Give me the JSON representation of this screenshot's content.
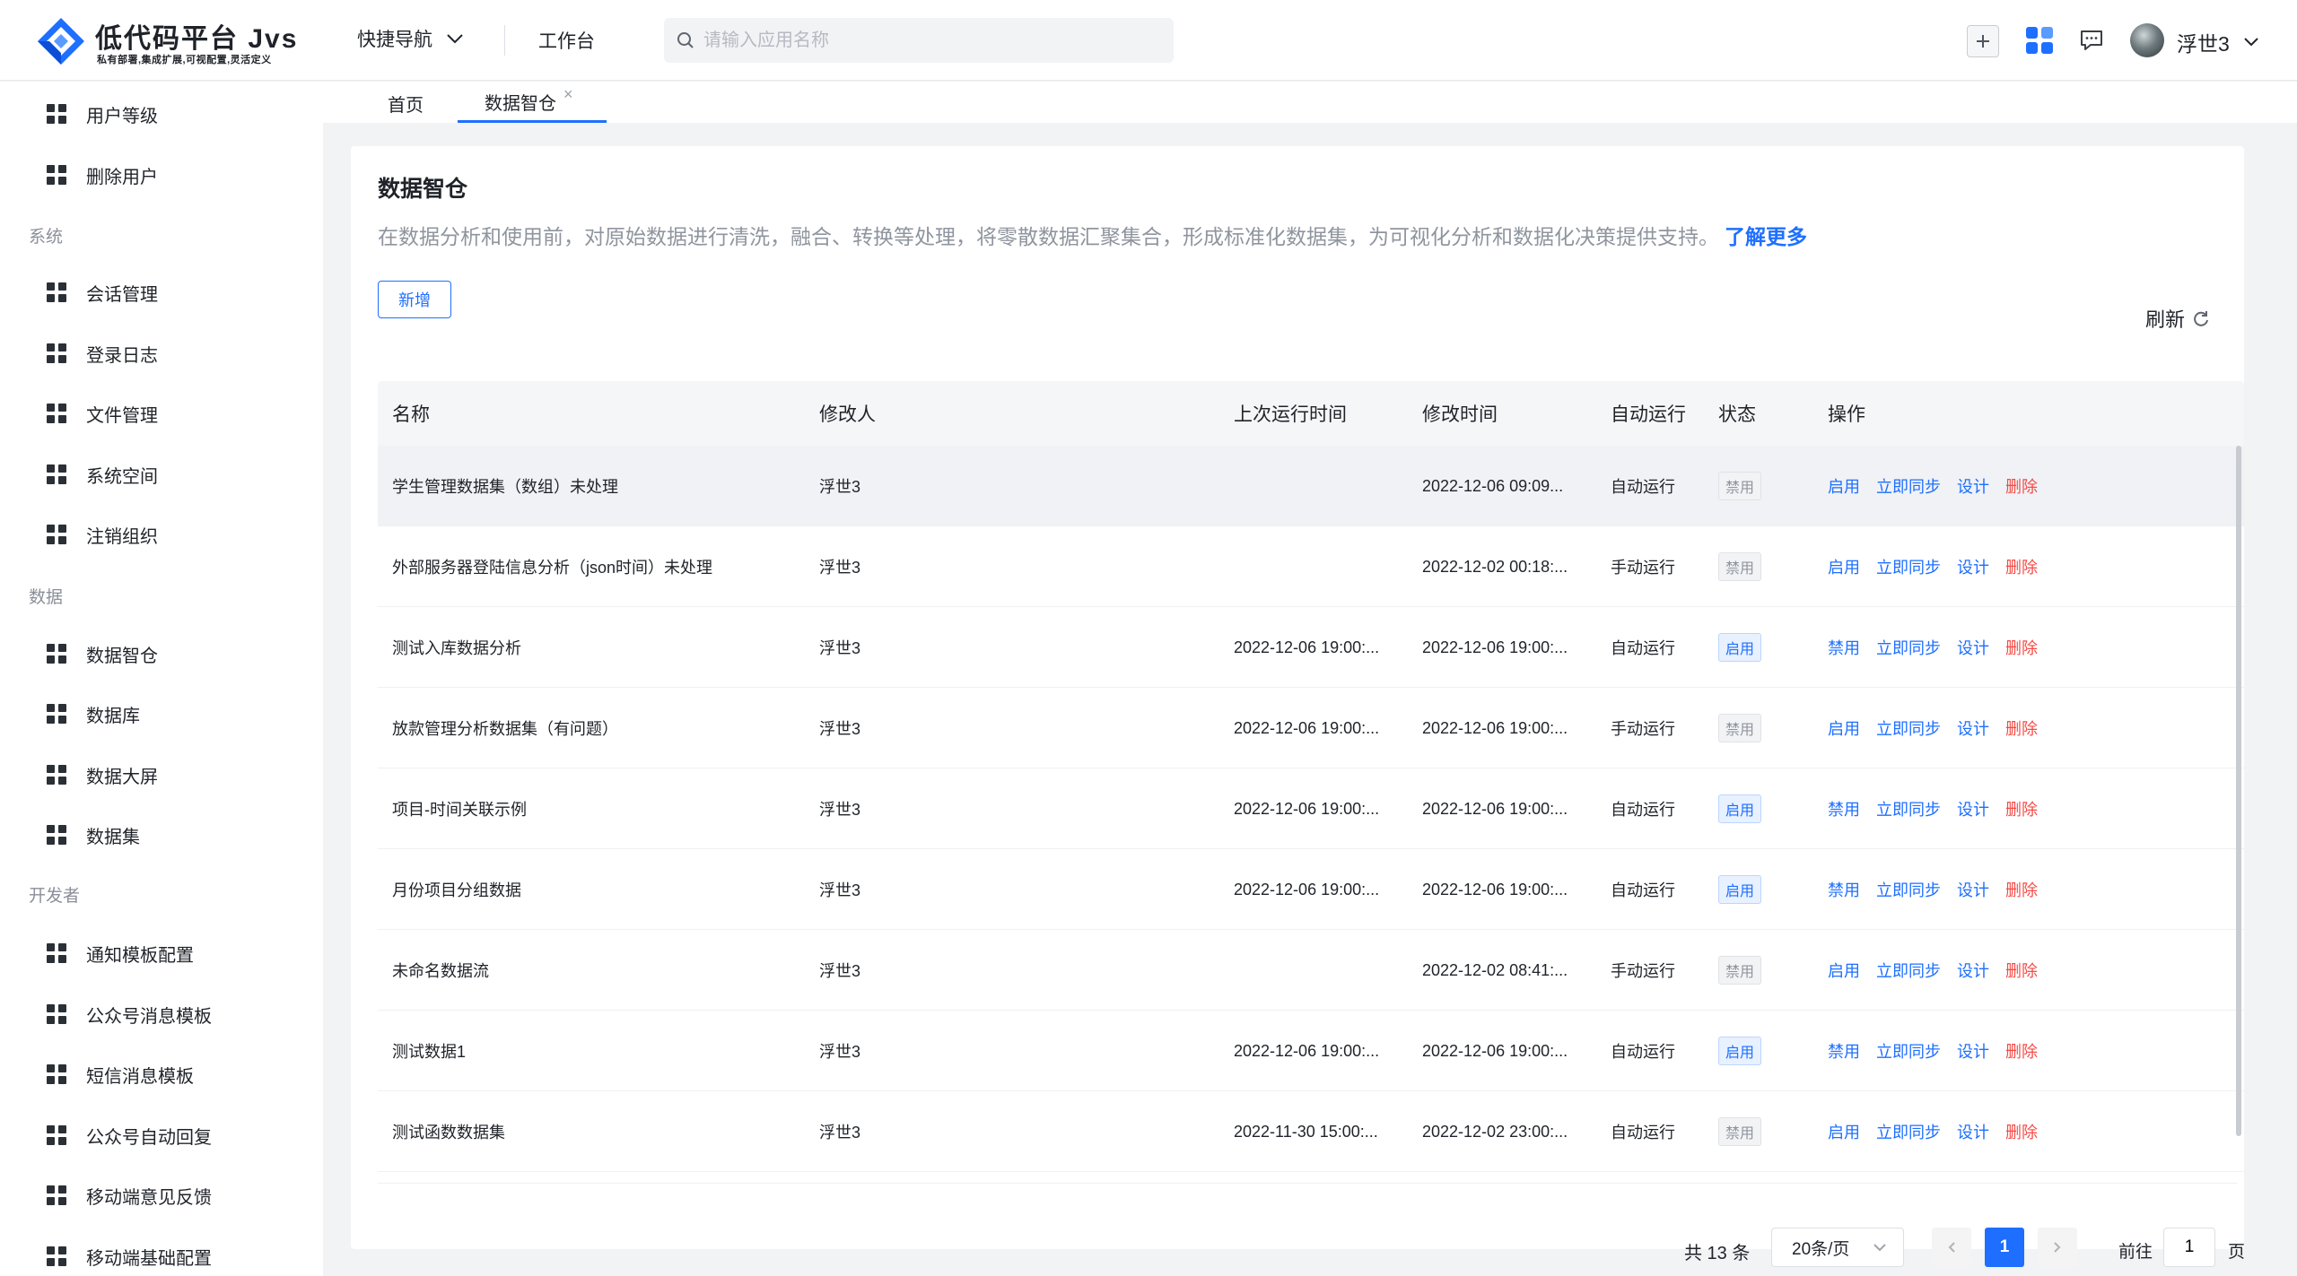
{
  "header": {
    "logo_title": "低代码平台 Jvs",
    "logo_subtitle": "私有部署,集成扩展,可视配置,灵活定义",
    "quick_nav_label": "快捷导航",
    "workbench_label": "工作台",
    "search_placeholder": "请输入应用名称",
    "user_name": "浮世3",
    "brand_color": "#1e6fff"
  },
  "sidebar": {
    "items_top": [
      {
        "label": "用户等级"
      },
      {
        "label": "删除用户"
      }
    ],
    "groups": [
      {
        "title": "系统",
        "items": [
          {
            "label": "会话管理"
          },
          {
            "label": "登录日志"
          },
          {
            "label": "文件管理"
          },
          {
            "label": "系统空间"
          },
          {
            "label": "注销组织"
          }
        ]
      },
      {
        "title": "数据",
        "items": [
          {
            "label": "数据智仓"
          },
          {
            "label": "数据库"
          },
          {
            "label": "数据大屏"
          },
          {
            "label": "数据集"
          }
        ]
      },
      {
        "title": "开发者",
        "items": [
          {
            "label": "通知模板配置"
          },
          {
            "label": "公众号消息模板"
          },
          {
            "label": "短信消息模板"
          },
          {
            "label": "公众号自动回复"
          },
          {
            "label": "移动端意见反馈"
          },
          {
            "label": "移动端基础配置"
          }
        ]
      }
    ]
  },
  "tabs": {
    "home": "首页",
    "active": "数据智仓",
    "close_glyph": "×"
  },
  "page": {
    "title": "数据智仓",
    "description": "在数据分析和使用前，对原始数据进行清洗，融合、转换等处理，将零散数据汇聚集合，形成标准化数据集，为可视化分析和数据化决策提供支持。",
    "learn_more": "了解更多",
    "new_button": "新增",
    "refresh_label": "刷新"
  },
  "table": {
    "columns": [
      "名称",
      "修改人",
      "上次运行时间",
      "修改时间",
      "自动运行",
      "状态",
      "操作"
    ],
    "rows": [
      {
        "name": "学生管理数据集（数组）未处理",
        "modifier": "浮世3",
        "last_run": "",
        "modified": "2022-12-06 09:09...",
        "auto": "自动运行",
        "status": "禁用",
        "toggle": "启用",
        "sync": "立即同步",
        "design": "设计",
        "delete": "删除"
      },
      {
        "name": "外部服务器登陆信息分析（json时间）未处理",
        "modifier": "浮世3",
        "last_run": "",
        "modified": "2022-12-02 00:18:...",
        "auto": "手动运行",
        "status": "禁用",
        "toggle": "启用",
        "sync": "立即同步",
        "design": "设计",
        "delete": "删除"
      },
      {
        "name": "测试入库数据分析",
        "modifier": "浮世3",
        "last_run": "2022-12-06 19:00:...",
        "modified": "2022-12-06 19:00:...",
        "auto": "自动运行",
        "status": "启用",
        "toggle": "禁用",
        "sync": "立即同步",
        "design": "设计",
        "delete": "删除"
      },
      {
        "name": "放款管理分析数据集（有问题）",
        "modifier": "浮世3",
        "last_run": "2022-12-06 19:00:...",
        "modified": "2022-12-06 19:00:...",
        "auto": "手动运行",
        "status": "禁用",
        "toggle": "启用",
        "sync": "立即同步",
        "design": "设计",
        "delete": "删除"
      },
      {
        "name": "项目-时间关联示例",
        "modifier": "浮世3",
        "last_run": "2022-12-06 19:00:...",
        "modified": "2022-12-06 19:00:...",
        "auto": "自动运行",
        "status": "启用",
        "toggle": "禁用",
        "sync": "立即同步",
        "design": "设计",
        "delete": "删除"
      },
      {
        "name": "月份项目分组数据",
        "modifier": "浮世3",
        "last_run": "2022-12-06 19:00:...",
        "modified": "2022-12-06 19:00:...",
        "auto": "自动运行",
        "status": "启用",
        "toggle": "禁用",
        "sync": "立即同步",
        "design": "设计",
        "delete": "删除"
      },
      {
        "name": "未命名数据流",
        "modifier": "浮世3",
        "last_run": "",
        "modified": "2022-12-02 08:41:...",
        "auto": "手动运行",
        "status": "禁用",
        "toggle": "启用",
        "sync": "立即同步",
        "design": "设计",
        "delete": "删除"
      },
      {
        "name": "测试数据1",
        "modifier": "浮世3",
        "last_run": "2022-12-06 19:00:...",
        "modified": "2022-12-06 19:00:...",
        "auto": "自动运行",
        "status": "启用",
        "toggle": "禁用",
        "sync": "立即同步",
        "design": "设计",
        "delete": "删除"
      },
      {
        "name": "测试函数数据集",
        "modifier": "浮世3",
        "last_run": "2022-11-30 15:00:...",
        "modified": "2022-12-02 23:00:...",
        "auto": "自动运行",
        "status": "禁用",
        "toggle": "启用",
        "sync": "立即同步",
        "design": "设计",
        "delete": "删除"
      }
    ]
  },
  "pagination": {
    "total": "共 13 条",
    "page_size": "20条/页",
    "current_page": "1",
    "goto_label": "前往",
    "goto_value": "1",
    "page_unit": "页"
  }
}
